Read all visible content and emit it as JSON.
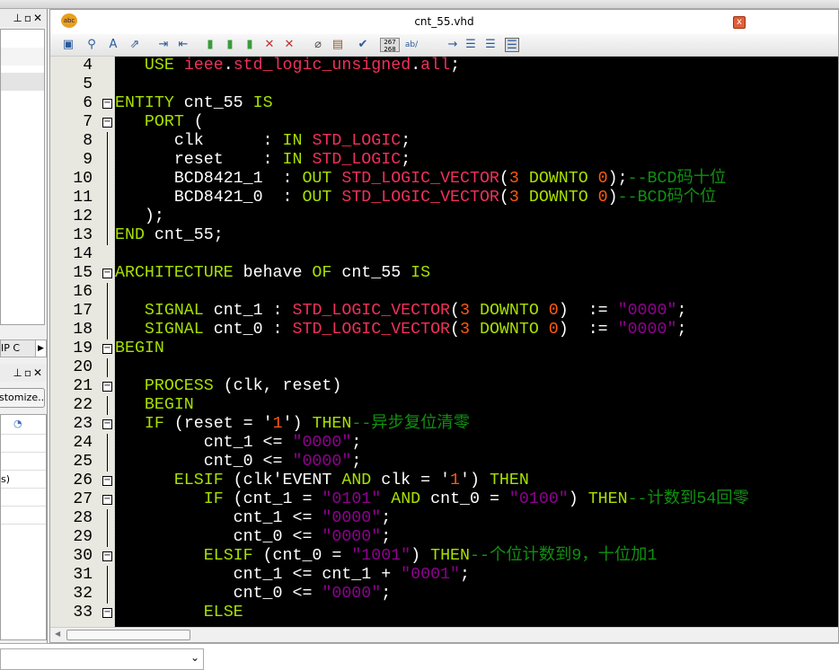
{
  "editor": {
    "file_name": "cnt_55.vhd",
    "close_label": "x",
    "lc_label_top": "267",
    "lc_label_bottom": "268",
    "ab_label": "ab/"
  },
  "left_panel": {
    "ip_tab": "IP C",
    "customize_label": "stomize...",
    "row_fragment": "s)"
  },
  "colors": {
    "keyword": "#a8e000",
    "type": "#f0305a",
    "number": "#ff5a10",
    "string": "#900090",
    "comment": "#109010",
    "background": "#000000"
  },
  "code": {
    "first_line": 4,
    "lines": [
      [
        [
          "tx",
          "   "
        ],
        [
          "kw",
          "USE"
        ],
        [
          "tx",
          " "
        ],
        [
          "ty",
          "ieee"
        ],
        [
          "tx",
          "."
        ],
        [
          "ty",
          "std_logic_unsigned"
        ],
        [
          "tx",
          "."
        ],
        [
          "ty",
          "all"
        ],
        [
          "tx",
          ";"
        ]
      ],
      [],
      [
        [
          "kw",
          "ENTITY"
        ],
        [
          "tx",
          " cnt_55 "
        ],
        [
          "kw",
          "IS"
        ]
      ],
      [
        [
          "tx",
          "   "
        ],
        [
          "kw",
          "PORT"
        ],
        [
          "tx",
          " ("
        ]
      ],
      [
        [
          "tx",
          "      clk      : "
        ],
        [
          "kw",
          "IN"
        ],
        [
          "tx",
          " "
        ],
        [
          "ty",
          "STD_LOGIC"
        ],
        [
          "tx",
          ";"
        ]
      ],
      [
        [
          "tx",
          "      reset    : "
        ],
        [
          "kw",
          "IN"
        ],
        [
          "tx",
          " "
        ],
        [
          "ty",
          "STD_LOGIC"
        ],
        [
          "tx",
          ";"
        ]
      ],
      [
        [
          "tx",
          "      BCD8421_1  : "
        ],
        [
          "kw",
          "OUT"
        ],
        [
          "tx",
          " "
        ],
        [
          "ty",
          "STD_LOGIC_VECTOR"
        ],
        [
          "tx",
          "("
        ],
        [
          "nm",
          "3"
        ],
        [
          "tx",
          " "
        ],
        [
          "kw",
          "DOWNTO"
        ],
        [
          "tx",
          " "
        ],
        [
          "nm",
          "0"
        ],
        [
          "tx",
          ");"
        ],
        [
          "cm",
          "--BCD码十位"
        ]
      ],
      [
        [
          "tx",
          "      BCD8421_0  : "
        ],
        [
          "kw",
          "OUT"
        ],
        [
          "tx",
          " "
        ],
        [
          "ty",
          "STD_LOGIC_VECTOR"
        ],
        [
          "tx",
          "("
        ],
        [
          "nm",
          "3"
        ],
        [
          "tx",
          " "
        ],
        [
          "kw",
          "DOWNTO"
        ],
        [
          "tx",
          " "
        ],
        [
          "nm",
          "0"
        ],
        [
          "tx",
          ")"
        ],
        [
          "cm",
          "--BCD码个位"
        ]
      ],
      [
        [
          "tx",
          "   );"
        ]
      ],
      [
        [
          "kw",
          "END"
        ],
        [
          "tx",
          " cnt_55;"
        ]
      ],
      [],
      [
        [
          "kw",
          "ARCHITECTURE"
        ],
        [
          "tx",
          " behave "
        ],
        [
          "kw",
          "OF"
        ],
        [
          "tx",
          " cnt_55 "
        ],
        [
          "kw",
          "IS"
        ]
      ],
      [],
      [
        [
          "tx",
          "   "
        ],
        [
          "kw",
          "SIGNAL"
        ],
        [
          "tx",
          " cnt_1 : "
        ],
        [
          "ty",
          "STD_LOGIC_VECTOR"
        ],
        [
          "tx",
          "("
        ],
        [
          "nm",
          "3"
        ],
        [
          "tx",
          " "
        ],
        [
          "kw",
          "DOWNTO"
        ],
        [
          "tx",
          " "
        ],
        [
          "nm",
          "0"
        ],
        [
          "tx",
          ")  := "
        ],
        [
          "st",
          "\"0000\""
        ],
        [
          "tx",
          ";"
        ]
      ],
      [
        [
          "tx",
          "   "
        ],
        [
          "kw",
          "SIGNAL"
        ],
        [
          "tx",
          " cnt_0 : "
        ],
        [
          "ty",
          "STD_LOGIC_VECTOR"
        ],
        [
          "tx",
          "("
        ],
        [
          "nm",
          "3"
        ],
        [
          "tx",
          " "
        ],
        [
          "kw",
          "DOWNTO"
        ],
        [
          "tx",
          " "
        ],
        [
          "nm",
          "0"
        ],
        [
          "tx",
          ")  := "
        ],
        [
          "st",
          "\"0000\""
        ],
        [
          "tx",
          ";"
        ]
      ],
      [
        [
          "kw",
          "BEGIN"
        ]
      ],
      [],
      [
        [
          "tx",
          "   "
        ],
        [
          "kw",
          "PROCESS"
        ],
        [
          "tx",
          " (clk, reset)"
        ]
      ],
      [
        [
          "tx",
          "   "
        ],
        [
          "kw",
          "BEGIN"
        ]
      ],
      [
        [
          "tx",
          "   "
        ],
        [
          "kw",
          "IF"
        ],
        [
          "tx",
          " (reset = '"
        ],
        [
          "nm",
          "1"
        ],
        [
          "tx",
          "') "
        ],
        [
          "kw",
          "THEN"
        ],
        [
          "cm",
          "--异步复位清零"
        ]
      ],
      [
        [
          "tx",
          "         cnt_1 <= "
        ],
        [
          "st",
          "\"0000\""
        ],
        [
          "tx",
          ";"
        ]
      ],
      [
        [
          "tx",
          "         cnt_0 <= "
        ],
        [
          "st",
          "\"0000\""
        ],
        [
          "tx",
          ";"
        ]
      ],
      [
        [
          "tx",
          "      "
        ],
        [
          "kw",
          "ELSIF"
        ],
        [
          "tx",
          " (clk'EVENT "
        ],
        [
          "kw",
          "AND"
        ],
        [
          "tx",
          " clk = '"
        ],
        [
          "nm",
          "1"
        ],
        [
          "tx",
          "') "
        ],
        [
          "kw",
          "THEN"
        ]
      ],
      [
        [
          "tx",
          "         "
        ],
        [
          "kw",
          "IF"
        ],
        [
          "tx",
          " (cnt_1 = "
        ],
        [
          "st",
          "\"0101\""
        ],
        [
          "tx",
          " "
        ],
        [
          "kw",
          "AND"
        ],
        [
          "tx",
          " cnt_0 = "
        ],
        [
          "st",
          "\"0100\""
        ],
        [
          "tx",
          ") "
        ],
        [
          "kw",
          "THEN"
        ],
        [
          "cm",
          "--计数到54回零"
        ]
      ],
      [
        [
          "tx",
          "            cnt_1 <= "
        ],
        [
          "st",
          "\"0000\""
        ],
        [
          "tx",
          ";"
        ]
      ],
      [
        [
          "tx",
          "            cnt_0 <= "
        ],
        [
          "st",
          "\"0000\""
        ],
        [
          "tx",
          ";"
        ]
      ],
      [
        [
          "tx",
          "         "
        ],
        [
          "kw",
          "ELSIF"
        ],
        [
          "tx",
          " (cnt_0 = "
        ],
        [
          "st",
          "\"1001\""
        ],
        [
          "tx",
          ") "
        ],
        [
          "kw",
          "THEN"
        ],
        [
          "cm",
          "--个位计数到9，十位加1"
        ]
      ],
      [
        [
          "tx",
          "            cnt_1 <= cnt_1 + "
        ],
        [
          "st",
          "\"0001\""
        ],
        [
          "tx",
          ";"
        ]
      ],
      [
        [
          "tx",
          "            cnt_0 <= "
        ],
        [
          "st",
          "\"0000\""
        ],
        [
          "tx",
          ";"
        ]
      ],
      [
        [
          "tx",
          "         "
        ],
        [
          "kw",
          "ELSE"
        ]
      ]
    ],
    "fold_lines": [
      6,
      7,
      15,
      19,
      21,
      23,
      26,
      27,
      30,
      33
    ]
  }
}
